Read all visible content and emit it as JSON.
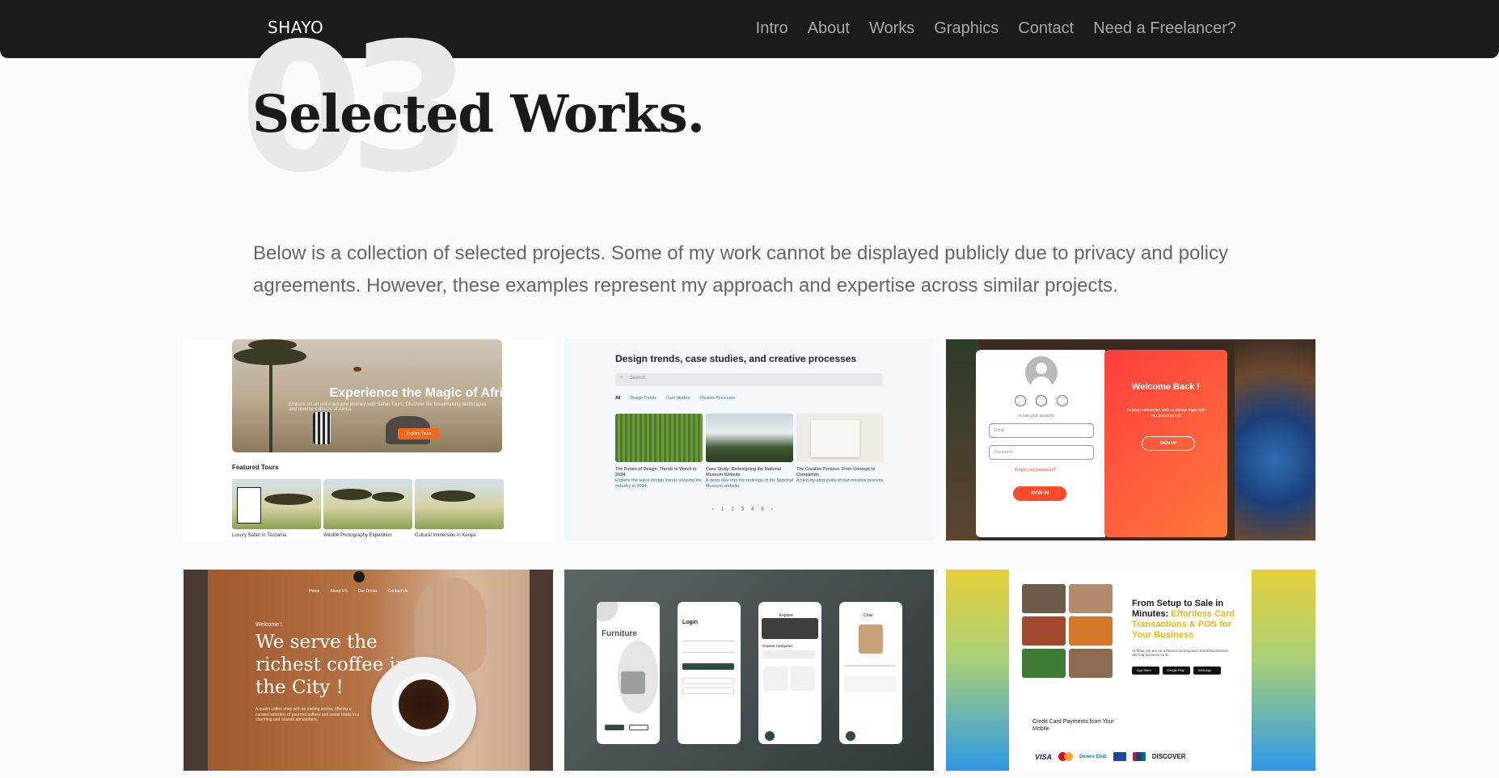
{
  "nav": {
    "brand": "SHAYO",
    "links": [
      "Intro",
      "About",
      "Works",
      "Graphics",
      "Contact",
      "Need a Freelancer?"
    ]
  },
  "section": {
    "number": "03",
    "title": "Selected Works.",
    "intro": "Below is a collection of selected projects. Some of my work cannot be displayed publicly due to privacy and policy agreements. However, these examples represent my approach and expertise across similar projects."
  },
  "projects": {
    "safari": {
      "headline": "Experience the Magic of Afric",
      "sub": "Embark on an unforgettable journey with Safari Tours. Discover the breathtaking landscapes and diverse cultures of Africa.",
      "button": "Explore Tours",
      "featured_label": "Featured Tours",
      "tours": [
        "Luxury Safari in Tanzania",
        "Wildlife Photography Expedition",
        "Cultural Immersion in Kenya"
      ]
    },
    "blog": {
      "heading": "Design trends, case studies, and creative processes",
      "search_placeholder": "Search",
      "tabs": [
        "All",
        "Design Trends",
        "Case Studies",
        "Creative Processes"
      ],
      "posts": [
        {
          "title": "The Future of Design: Trends to Watch in 2024",
          "desc": "Explore the latest design trends shaping the industry in 2024."
        },
        {
          "title": "Case Study: Redesigning the National Museum Website",
          "desc": "A deep dive into the redesign of the National Museum website."
        },
        {
          "title": "The Creative Process: From Concept to Completion",
          "desc": "A step-by-step guide to our creative process."
        }
      ],
      "pages": [
        "‹",
        "1",
        "2",
        "3",
        "4",
        "5",
        "›"
      ]
    },
    "login": {
      "alt_text": "or use your account",
      "email_placeholder": "Email",
      "password_placeholder": "Password",
      "forgot": "Forgot your password?",
      "signin": "SIGN IN",
      "welcome": "Welcome Back !",
      "welcome_sub": "To keep connected with us please login with you personal info",
      "signup": "SIGN UP"
    },
    "coffee": {
      "menu": [
        "Home",
        "About US",
        "Our Drinks",
        "Contact Us"
      ],
      "welcome": "Welcome !",
      "headline": "We serve the richest coffee in the City !",
      "para": "A quaint coffee shop with an inviting aroma, offering a curated selection of gourmet coffees and sweet treats in a charming and relaxed atmosphere."
    },
    "furniture": {
      "brand": "Furniture",
      "login_title": "Login",
      "explore_title": "Explore",
      "popular": "Popular categories",
      "chair_title": "Chair"
    },
    "payments": {
      "headline_plain": "From Setup to Sale in Minutes: ",
      "headline_accent": "Effortless Card Transactions & POS for Your Business",
      "body": "At Movi, we are on a mission to empower Small Businesses with big business tools.",
      "stores": [
        "App Store",
        "Google Play",
        "Web App"
      ],
      "cc_label": "Credit Card Payments from Your Mobile",
      "cards": [
        "VISA",
        "Mastercard",
        "Diners Club",
        "Union Pay",
        "UnionPay",
        "DISCOVER"
      ]
    }
  },
  "colors": {
    "navbar": "#1b1b1b",
    "accent_orange": "#ef6a21",
    "accent_red": "#ff4b2b",
    "accent_yellow": "#f0b90b"
  }
}
